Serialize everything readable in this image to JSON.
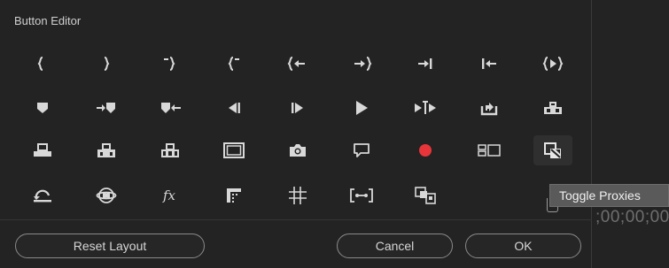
{
  "dialog": {
    "title": "Button Editor"
  },
  "buttons": {
    "reset_layout": "Reset Layout",
    "cancel": "Cancel",
    "ok": "OK"
  },
  "tooltip": {
    "text": "Toggle Proxies"
  },
  "timecode": {
    "text": ";00;00;00"
  },
  "icon_rows": [
    [
      "mark-in-icon",
      "mark-out-icon",
      "mark-clip-in-icon",
      "mark-clip-out-icon",
      "go-to-in-icon",
      "go-to-out-icon",
      "go-to-next-edit-icon",
      "go-to-previous-edit-icon",
      "play-in-to-out-icon"
    ],
    [
      "add-marker-icon",
      "go-to-next-marker-icon",
      "go-to-previous-marker-icon",
      "step-back-icon",
      "step-forward-icon",
      "play-icon",
      "play-around-icon",
      "export-frame-icon",
      "lift-icon"
    ],
    [
      "insert-icon",
      "overwrite-icon",
      "extract-icon",
      "safe-margins-icon",
      "camera-icon",
      "comment-icon",
      "record-icon",
      "multi-camera-icon",
      "toggle-proxies-icon"
    ],
    [
      "loop-icon",
      "vr-video-icon",
      "fx-icon",
      "comparison-view-icon",
      "grid-icon",
      "trim-icon",
      "multi-camera-record-icon"
    ]
  ],
  "colors": {
    "record": "#e8353a",
    "icon": "#d8d8d8",
    "background": "#232323"
  }
}
